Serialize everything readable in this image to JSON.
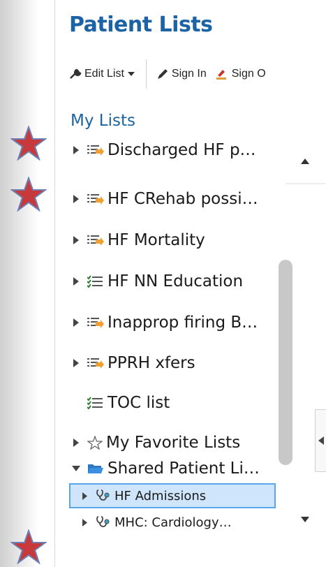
{
  "header": {
    "title": "Patient Lists"
  },
  "toolbar": {
    "edit_list": "Edit List",
    "sign_in": "Sign In",
    "sign_out": "Sign O"
  },
  "section": {
    "my_lists": "My Lists"
  },
  "tree": [
    {
      "label": "Discharged HF p…",
      "icon": "list-icon",
      "expandable": true
    },
    {
      "label": "HF CRehab possi…",
      "icon": "list-icon",
      "expandable": true
    },
    {
      "label": "HF Mortality",
      "icon": "list-icon",
      "expandable": true
    },
    {
      "label": "HF NN Education",
      "icon": "checklist-icon",
      "expandable": true
    },
    {
      "label": "Inapprop firing B…",
      "icon": "list-icon",
      "expandable": true
    },
    {
      "label": "PPRH xfers",
      "icon": "list-icon",
      "expandable": true
    },
    {
      "label": "TOC list",
      "icon": "checklist-icon",
      "expandable": false
    },
    {
      "label": "My Favorite Lists",
      "icon": "star-outline-icon",
      "expandable": true
    },
    {
      "label": "Shared Patient Li…",
      "icon": "folder-icon",
      "expandable": true,
      "expanded": true
    },
    {
      "label": "HF Admissions",
      "icon": "stethoscope-icon",
      "expandable": true,
      "selected": true
    },
    {
      "label": "MHC: Cardiology…",
      "icon": "stethoscope-icon",
      "expandable": true
    }
  ],
  "colors": {
    "title_blue": "#1b63a5",
    "selected_bg": "#cfe5fb",
    "selected_border": "#5aa6ea",
    "annotation_star": "#c8393b"
  }
}
